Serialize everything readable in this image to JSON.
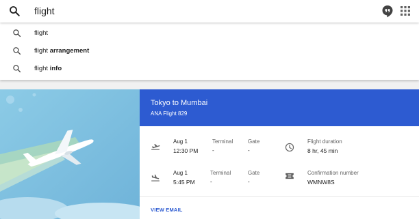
{
  "search": {
    "query": "flight"
  },
  "suggestions": [
    {
      "plain": "flight",
      "bold": ""
    },
    {
      "plain": "flight ",
      "bold": "arrangement"
    },
    {
      "plain": "flight ",
      "bold": "info"
    }
  ],
  "card": {
    "route": "Tokyo to Mumbai",
    "flight": "ANA Flight 829",
    "departure": {
      "date": "Aug 1",
      "time": "12:30 PM",
      "terminal_label": "Terminal",
      "terminal": "-",
      "gate_label": "Gate",
      "gate": "-"
    },
    "arrival": {
      "date": "Aug 1",
      "time": "5:45 PM",
      "terminal_label": "Terminal",
      "terminal": "-",
      "gate_label": "Gate",
      "gate": "-"
    },
    "duration_label": "Flight duration",
    "duration": "8 hr, 45 min",
    "confirmation_label": "Confirmation number",
    "confirmation": "WMNW8S",
    "view_email": "VIEW EMAIL"
  },
  "colors": {
    "accent": "#2d5bd1",
    "sky": "#7fbfe0"
  }
}
